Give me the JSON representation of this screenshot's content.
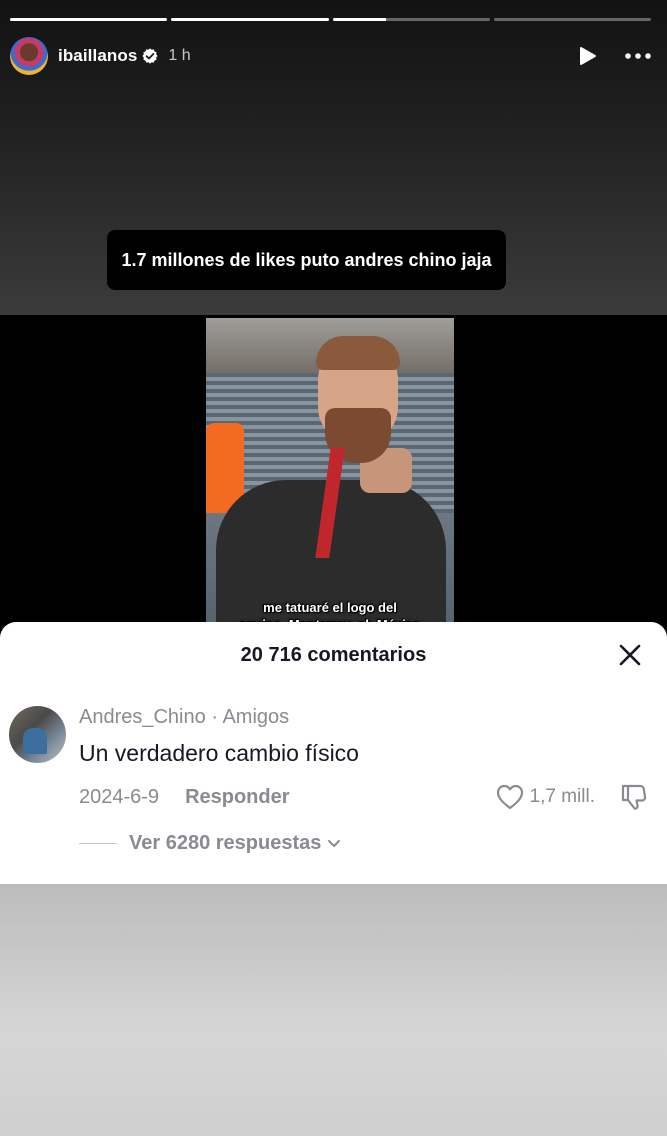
{
  "story": {
    "progress": [
      1,
      1,
      0.34,
      0
    ],
    "username": "ibaillanos",
    "time": "1 h",
    "caption": "1.7 millones de likes puto andres chino jaja",
    "icons": {
      "verified": "verified-badge-icon",
      "play": "play-icon",
      "more": "more-icon"
    }
  },
  "video": {
    "subtitle_line1": "me tatuaré el logo del",
    "subtitle_line2": "equipo, Monterrey, eh México"
  },
  "comments": {
    "title": "20 716 comentarios",
    "items": [
      {
        "author": "Andres_Chino",
        "relation": "Amigos",
        "text": "Un verdadero cambio físico",
        "date": "2024-6-9",
        "reply_label": "Responder",
        "likes": "1,7 mill.",
        "view_replies": "Ver 6280 respuestas"
      }
    ]
  },
  "colors": {
    "sheet_bg": "#ffffff",
    "text_primary": "#161823",
    "text_secondary": "#8a8b91"
  }
}
